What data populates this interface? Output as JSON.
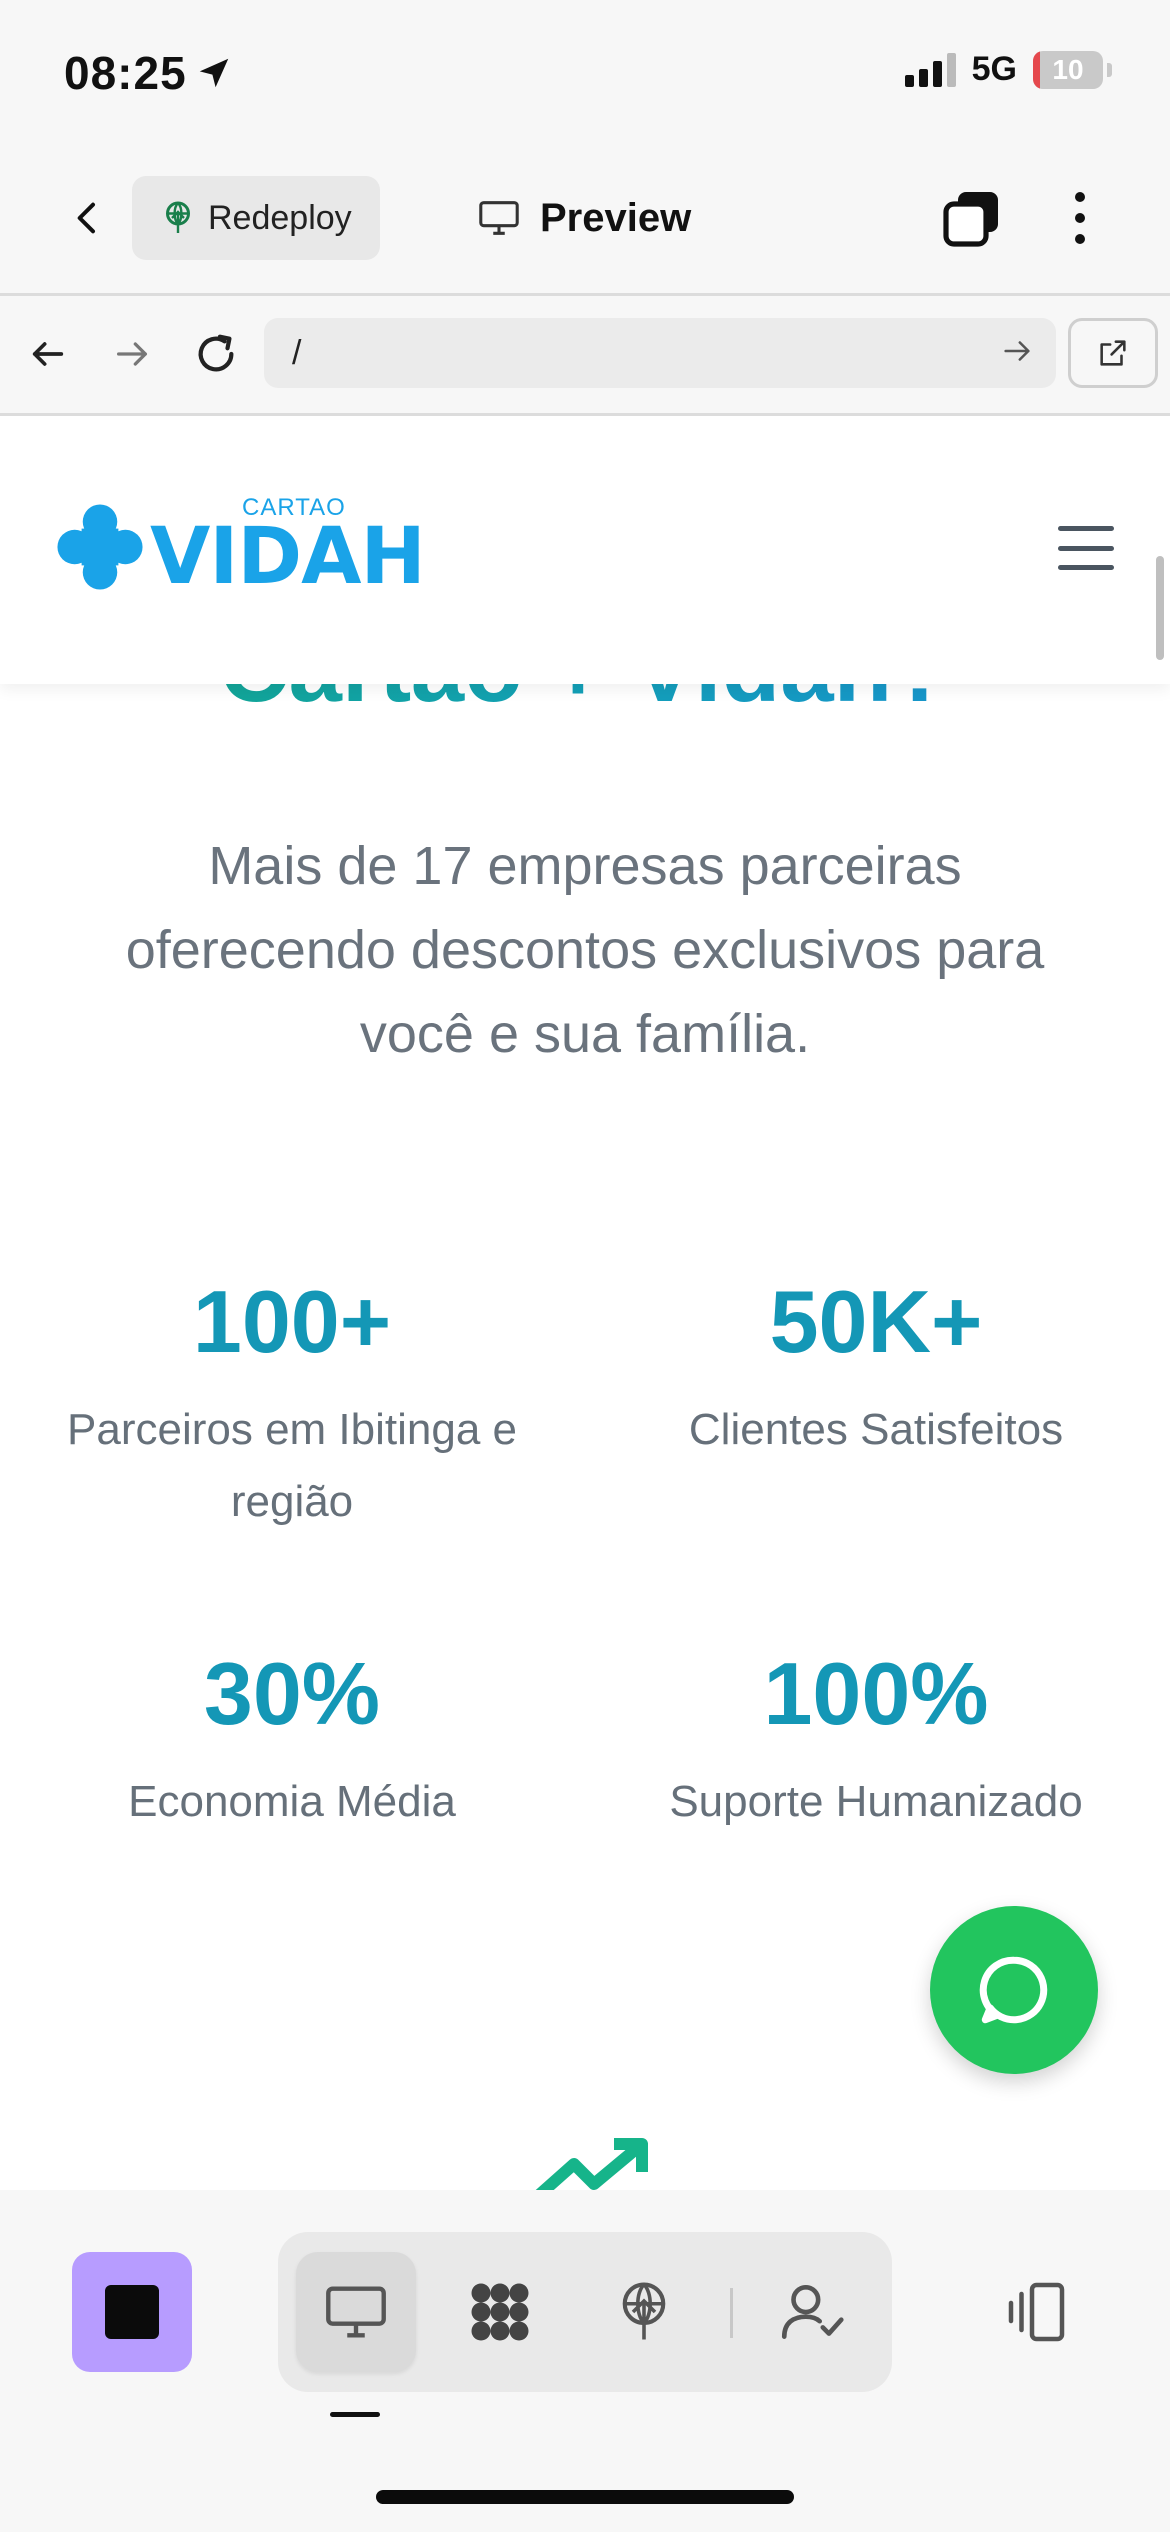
{
  "status_bar": {
    "time": "08:25",
    "network": "5G",
    "battery": "10",
    "battery_level": 0.1
  },
  "app_header": {
    "redeploy_label": "Redeploy",
    "preview_label": "Preview"
  },
  "browser": {
    "url": "/"
  },
  "site": {
    "logo_small": "CARTAO",
    "logo_big": "VIDAH",
    "partial_title": "Cartão + Vidah?",
    "subtitle": "Mais de 17 empresas parceiras oferecendo descontos exclusivos para você e sua família.",
    "stats": [
      {
        "value": "100+",
        "label": "Parceiros em Ibitinga e região"
      },
      {
        "value": "50K+",
        "label": "Clientes Satisfeitos"
      },
      {
        "value": "30%",
        "label": "Economia Média"
      },
      {
        "value": "100%",
        "label": "Suporte Humanizado"
      }
    ]
  },
  "icons": {
    "status": [
      "location-arrow-icon",
      "signal-icon",
      "battery-icon"
    ],
    "header": [
      "chevron-left-icon",
      "deploy-icon",
      "monitor-icon",
      "tabs-icon",
      "more-vertical-icon"
    ],
    "browser": [
      "arrow-left-icon",
      "arrow-right-icon",
      "reload-icon",
      "arrow-right-icon",
      "external-link-icon"
    ],
    "site": [
      "logo-cross-icon",
      "hamburger-menu-icon",
      "whatsapp-icon",
      "trending-up-icon"
    ],
    "toolbar": [
      "stop-icon",
      "monitor-icon",
      "grid-icon",
      "deploy-icon",
      "user-check-icon",
      "device-toggle-icon"
    ]
  },
  "colors": {
    "brand_blue": "#1aa3e8",
    "stat_teal": "#1497b6",
    "whatsapp_green": "#22c55e",
    "stop_purple": "#b79cff"
  }
}
